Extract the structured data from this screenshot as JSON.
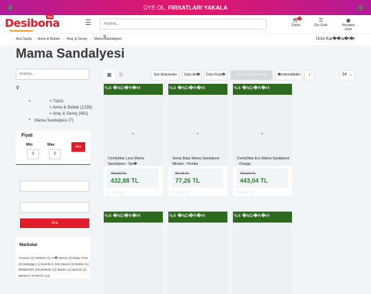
{
  "banner": {
    "text_prefix": "ÜYE OL,",
    "text_bold": "FIRSATLARI YAKALA"
  },
  "header": {
    "logo": "Desibona",
    "logo_tag": "Next",
    "search_placeholder": "Arama...",
    "cart_label": "Sepet",
    "login_label": "Giri Getir",
    "profile_label": "Hesapta Getir"
  },
  "breadcrumb": [
    "Ana Sayfa",
    "Anne & Bebek",
    "Araç & Gereç",
    "Mama Sandalyesi"
  ],
  "compare_label": "Ürün Kar��la�t�r",
  "page_title": "Mama Sandalyesi",
  "filter": {
    "search_placeholder": "Arama...",
    "categories": [
      "< Tümü",
      "< Anne & Bebek (1235)",
      "< Araç & Gereç (481)",
      "Mama Sandalyesi (7)"
    ],
    "price": {
      "title": "Fiyat",
      "min_label": "Min",
      "max_label": "Max",
      "min_value": "0",
      "max_value": "0",
      "button": "Ara"
    },
    "search_button": "Ara",
    "brands_title": "Markalar",
    "brands_text": "Amoma (1) AMEDA (1) Ar� Mama (4) Baby Time (9) Babyğgo (1) Bambino (25) Banat (1) Barbie (1) BEBEDOR (18) Bebelin (3) Betarn (2) Bionini (2) BRIGHT STARTS (14)"
  },
  "sort": {
    "options": [
      "Son Eklenenler",
      "Ürün Ad�",
      "Ürün Fiyat�",
      "Çok Görüntülenenler",
      "�ndirimdekiler"
    ],
    "per_page": "24"
  },
  "products": [
    {
      "badge": "%4 �ND�R�M",
      "name": "ComfyMax Luna Mama Sandalyesi - Sar�",
      "old_price": "450,92 TL",
      "price": "432,88 TL",
      "stars": "☆☆☆☆"
    },
    {
      "badge": "%4 �ND�R�M",
      "name": "Sema Baby Mama Sandalyesi Minderi - Pembe",
      "old_price": "80,48 TL",
      "price": "77,26 TL",
      "stars": "☆☆☆☆"
    },
    {
      "badge": "%4 �ND�R�M",
      "name": "ComfyMax Eco Mama Sandalyesi - Orange",
      "old_price": "461,50 TL",
      "price": "443,04 TL",
      "stars": "☆☆☆☆"
    },
    {
      "badge": "%4 �ND�R�M"
    },
    {
      "badge": "%4 �ND�R�M"
    },
    {
      "badge": "%4 �ND�R�M"
    }
  ]
}
